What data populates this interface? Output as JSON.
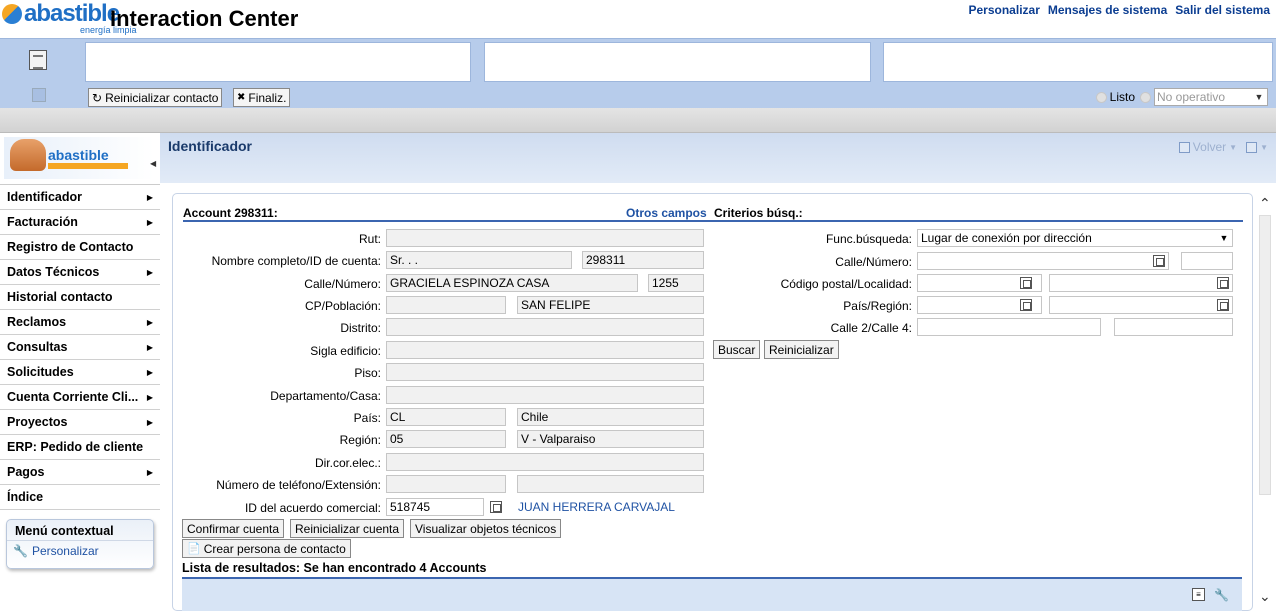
{
  "header": {
    "logo_word": "abastible",
    "logo_tagline": "energía limpia",
    "title": "Interaction Center",
    "links": [
      "Personalizar",
      "Mensajes de sistema",
      "Salir del sistema"
    ]
  },
  "toolbar": {
    "reset_contact_label": "Reinicializar contacto",
    "finalize_label": "Finaliz.",
    "status_ready": "Listo",
    "status_select_placeholder": "No operativo"
  },
  "sidebar": {
    "brand": "abastible",
    "items": [
      {
        "label": "Identificador",
        "has_submenu": true
      },
      {
        "label": "Facturación",
        "has_submenu": true
      },
      {
        "label": "Registro de Contacto",
        "has_submenu": false
      },
      {
        "label": "Datos Técnicos",
        "has_submenu": true
      },
      {
        "label": "Historial contacto",
        "has_submenu": false
      },
      {
        "label": "Reclamos",
        "has_submenu": true
      },
      {
        "label": "Consultas",
        "has_submenu": true
      },
      {
        "label": "Solicitudes",
        "has_submenu": true
      },
      {
        "label": "Cuenta Corriente Cli...",
        "has_submenu": true
      },
      {
        "label": "Proyectos",
        "has_submenu": true
      },
      {
        "label": "ERP: Pedido de cliente",
        "has_submenu": false
      },
      {
        "label": "Pagos",
        "has_submenu": true
      },
      {
        "label": "Índice",
        "has_submenu": false
      }
    ],
    "context_menu_title": "Menú contextual",
    "context_menu_item": "Personalizar"
  },
  "main": {
    "title": "Identificador",
    "back_label": "Volver",
    "account_title": "Account 298311:",
    "otros_campos": "Otros campos",
    "criterios": "Criterios búsq.:",
    "left_form": {
      "rut_label": "Rut:",
      "rut_value": "",
      "nombre_label": "Nombre completo/ID de cuenta:",
      "nombre_value": "Sr. . .",
      "cuenta_id": "298311",
      "calle_label": "Calle/Número:",
      "calle_value": "GRACIELA ESPINOZA CASA",
      "numero_value": "1255",
      "cp_label": "CP/Población:",
      "cp_value": "",
      "poblacion_value": "SAN FELIPE",
      "distrito_label": "Distrito:",
      "distrito_value": "",
      "sigla_label": "Sigla edificio:",
      "sigla_value": "",
      "piso_label": "Piso:",
      "piso_value": "",
      "depto_label": "Departamento/Casa:",
      "depto_value": "",
      "pais_label": "País:",
      "pais_code": "CL",
      "pais_name": "Chile",
      "region_label": "Región:",
      "region_code": "05",
      "region_name": "V - Valparaiso",
      "email_label": "Dir.cor.elec.:",
      "email_value": "",
      "tel_label": "Número de teléfono/Extensión:",
      "tel_value": "",
      "tel_ext": "",
      "acuerdo_label": "ID del acuerdo comercial:",
      "acuerdo_value": "518745",
      "acuerdo_name": "JUAN HERRERA CARVAJAL"
    },
    "right_form": {
      "func_label": "Func.búsqueda:",
      "func_value": "Lugar de conexión por dirección",
      "calle_label": "Calle/Número:",
      "cp_label": "Código postal/Localidad:",
      "pais_label": "País/Región:",
      "calle24_label": "Calle 2/Calle 4:",
      "search_button": "Buscar",
      "reset_button": "Reinicializar"
    },
    "buttons": {
      "confirm": "Confirmar cuenta",
      "reset_account": "Reinicializar cuenta",
      "tech_objects": "Visualizar objetos técnicos",
      "create_contact": "Crear persona de contacto"
    },
    "results_title": "Lista de resultados: Se han encontrado 4 Accounts"
  }
}
